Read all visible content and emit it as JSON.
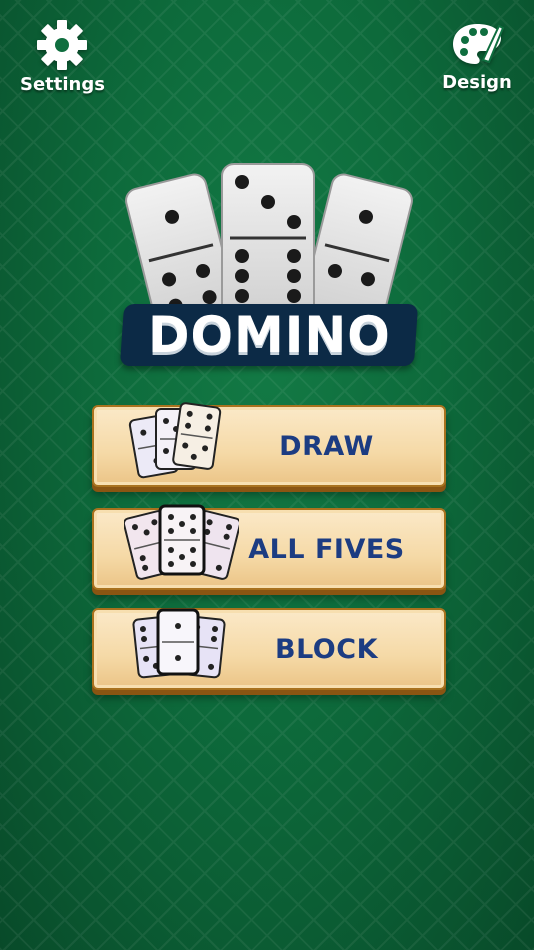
{
  "header": {
    "settings_label": "Settings",
    "settings_icon": "gear-icon",
    "design_label": "Design",
    "design_icon": "palette-icon"
  },
  "logo": {
    "title": "DOMINO"
  },
  "menu": {
    "items": [
      {
        "label": "DRAW",
        "icon": "domino-tiles-icon"
      },
      {
        "label": "ALL FIVES",
        "icon": "domino-tiles-icon"
      },
      {
        "label": "BLOCK",
        "icon": "domino-tiles-icon"
      }
    ]
  },
  "colors": {
    "background": "#0d6a3b",
    "button_face": "#f5d9a6",
    "button_text": "#1c3c82",
    "logo_plate": "#0c2a46"
  }
}
